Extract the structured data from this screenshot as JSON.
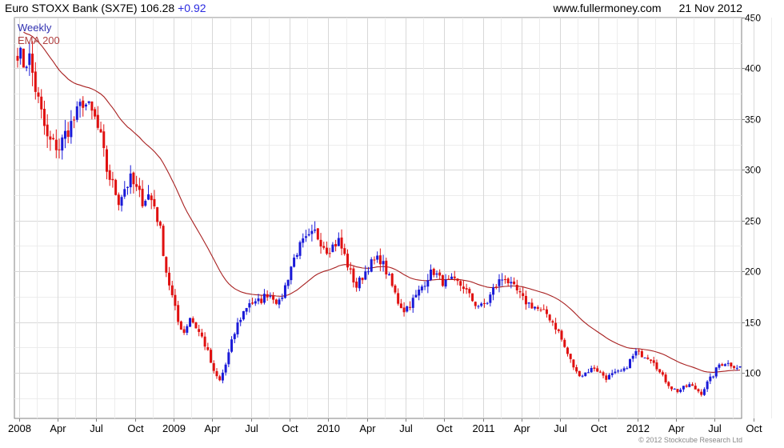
{
  "header": {
    "title": "Euro STOXX Bank (SX7E)",
    "last": "106.28",
    "change": "+0.92",
    "site": "www.fullermoney.com",
    "date": "21 Nov 2012"
  },
  "legend": {
    "weekly": "Weekly",
    "ema": "EMA 200"
  },
  "copyright": "© 2012 Stockcube Research Ltd",
  "colors": {
    "up": "#1a1ad8",
    "down": "#e01010",
    "ema": "#a82020",
    "grid": "#d8d8d8"
  },
  "chart_data": {
    "type": "candlestick",
    "frequency": "Weekly",
    "title": "Euro STOXX Bank (SX7E)",
    "x_tick_labels": [
      "2008",
      "Apr",
      "Jul",
      "Oct",
      "2009",
      "Apr",
      "Jul",
      "Oct",
      "2010",
      "Apr",
      "Jul",
      "Oct",
      "2011",
      "Apr",
      "Jul",
      "Oct",
      "2012",
      "Apr",
      "Jul",
      "Oct"
    ],
    "y_ticks": [
      100,
      150,
      200,
      250,
      300,
      350,
      400,
      450
    ],
    "ylim": [
      55,
      450
    ],
    "grid": true,
    "price_anchors": [
      [
        0,
        418
      ],
      [
        2,
        405
      ],
      [
        4,
        410
      ],
      [
        6,
        380
      ],
      [
        8,
        355
      ],
      [
        10,
        330
      ],
      [
        12,
        325
      ],
      [
        14,
        322
      ],
      [
        16,
        335
      ],
      [
        18,
        345
      ],
      [
        20,
        355
      ],
      [
        22,
        368
      ],
      [
        24,
        360
      ],
      [
        26,
        350
      ],
      [
        28,
        330
      ],
      [
        30,
        300
      ],
      [
        32,
        285
      ],
      [
        34,
        270
      ],
      [
        36,
        282
      ],
      [
        38,
        290
      ],
      [
        40,
        280
      ],
      [
        42,
        270
      ],
      [
        44,
        275
      ],
      [
        46,
        265
      ],
      [
        48,
        240
      ],
      [
        50,
        200
      ],
      [
        52,
        175
      ],
      [
        54,
        150
      ],
      [
        56,
        140
      ],
      [
        58,
        155
      ],
      [
        60,
        145
      ],
      [
        62,
        135
      ],
      [
        64,
        120
      ],
      [
        66,
        100
      ],
      [
        68,
        92
      ],
      [
        70,
        108
      ],
      [
        72,
        130
      ],
      [
        74,
        148
      ],
      [
        76,
        160
      ],
      [
        78,
        170
      ],
      [
        80,
        168
      ],
      [
        82,
        172
      ],
      [
        84,
        178
      ],
      [
        86,
        175
      ],
      [
        88,
        168
      ],
      [
        90,
        185
      ],
      [
        92,
        205
      ],
      [
        94,
        220
      ],
      [
        96,
        228
      ],
      [
        98,
        232
      ],
      [
        100,
        238
      ],
      [
        102,
        230
      ],
      [
        104,
        222
      ],
      [
        106,
        225
      ],
      [
        108,
        230
      ],
      [
        110,
        215
      ],
      [
        112,
        198
      ],
      [
        114,
        185
      ],
      [
        116,
        195
      ],
      [
        118,
        205
      ],
      [
        120,
        210
      ],
      [
        122,
        212
      ],
      [
        124,
        200
      ],
      [
        126,
        185
      ],
      [
        128,
        170
      ],
      [
        130,
        162
      ],
      [
        132,
        168
      ],
      [
        134,
        175
      ],
      [
        136,
        185
      ],
      [
        138,
        195
      ],
      [
        140,
        200
      ],
      [
        142,
        192
      ],
      [
        144,
        188
      ],
      [
        146,
        190
      ],
      [
        148,
        188
      ],
      [
        150,
        185
      ],
      [
        152,
        175
      ],
      [
        154,
        168
      ],
      [
        156,
        165
      ],
      [
        158,
        170
      ],
      [
        160,
        182
      ],
      [
        162,
        190
      ],
      [
        164,
        195
      ],
      [
        166,
        185
      ],
      [
        168,
        180
      ],
      [
        170,
        172
      ],
      [
        172,
        168
      ],
      [
        174,
        165
      ],
      [
        176,
        160
      ],
      [
        178,
        158
      ],
      [
        180,
        150
      ],
      [
        182,
        140
      ],
      [
        184,
        125
      ],
      [
        186,
        112
      ],
      [
        188,
        100
      ],
      [
        190,
        98
      ],
      [
        192,
        102
      ],
      [
        194,
        105
      ],
      [
        196,
        100
      ],
      [
        198,
        95
      ],
      [
        200,
        98
      ],
      [
        202,
        100
      ],
      [
        204,
        102
      ],
      [
        206,
        112
      ],
      [
        208,
        120
      ],
      [
        210,
        118
      ],
      [
        212,
        116
      ],
      [
        214,
        112
      ],
      [
        216,
        100
      ],
      [
        218,
        92
      ],
      [
        220,
        85
      ],
      [
        222,
        82
      ],
      [
        224,
        85
      ],
      [
        226,
        88
      ],
      [
        228,
        84
      ],
      [
        230,
        80
      ],
      [
        232,
        90
      ],
      [
        234,
        98
      ],
      [
        236,
        108
      ],
      [
        238,
        110
      ],
      [
        240,
        108
      ],
      [
        242,
        106
      ],
      [
        243,
        106.28
      ]
    ]
  }
}
